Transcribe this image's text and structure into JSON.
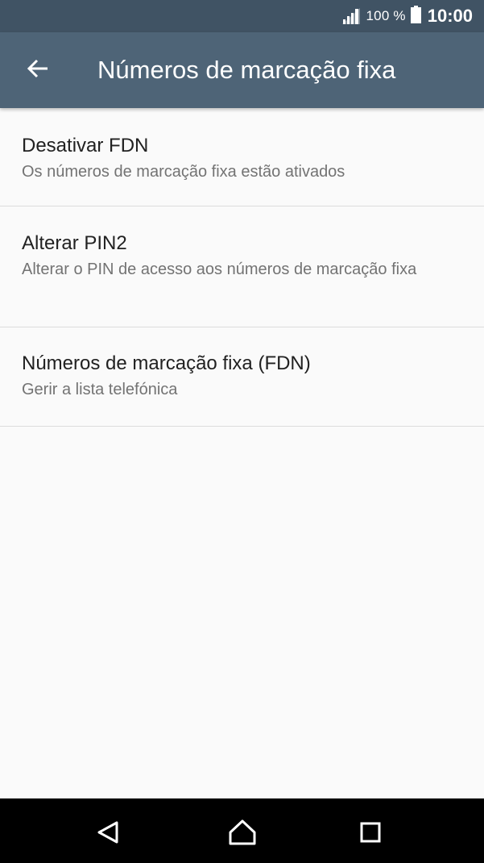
{
  "status_bar": {
    "battery_text": "100 %",
    "time": "10:00",
    "icons": [
      "signal-icon",
      "battery-icon"
    ]
  },
  "app_bar": {
    "title": "Números de marcação fixa",
    "back_icon": "arrow-back-icon"
  },
  "items": [
    {
      "title": "Desativar FDN",
      "summary": "Os números de marcação fixa estão ativados"
    },
    {
      "title": "Alterar PIN2",
      "summary": "Alterar o PIN de acesso aos números de marcação fixa"
    },
    {
      "title": "Números de marcação fixa (FDN)",
      "summary": "Gerir a lista telefónica"
    }
  ],
  "nav_bar": {
    "icons": [
      "nav-back-icon",
      "nav-home-icon",
      "nav-recents-icon"
    ]
  },
  "colors": {
    "status_bar": "#405364",
    "app_bar": "#4e6477",
    "background": "#fafafa",
    "title_text": "#212121",
    "summary_text": "#737373",
    "divider": "#dcdcdc",
    "nav_bar": "#000000"
  }
}
